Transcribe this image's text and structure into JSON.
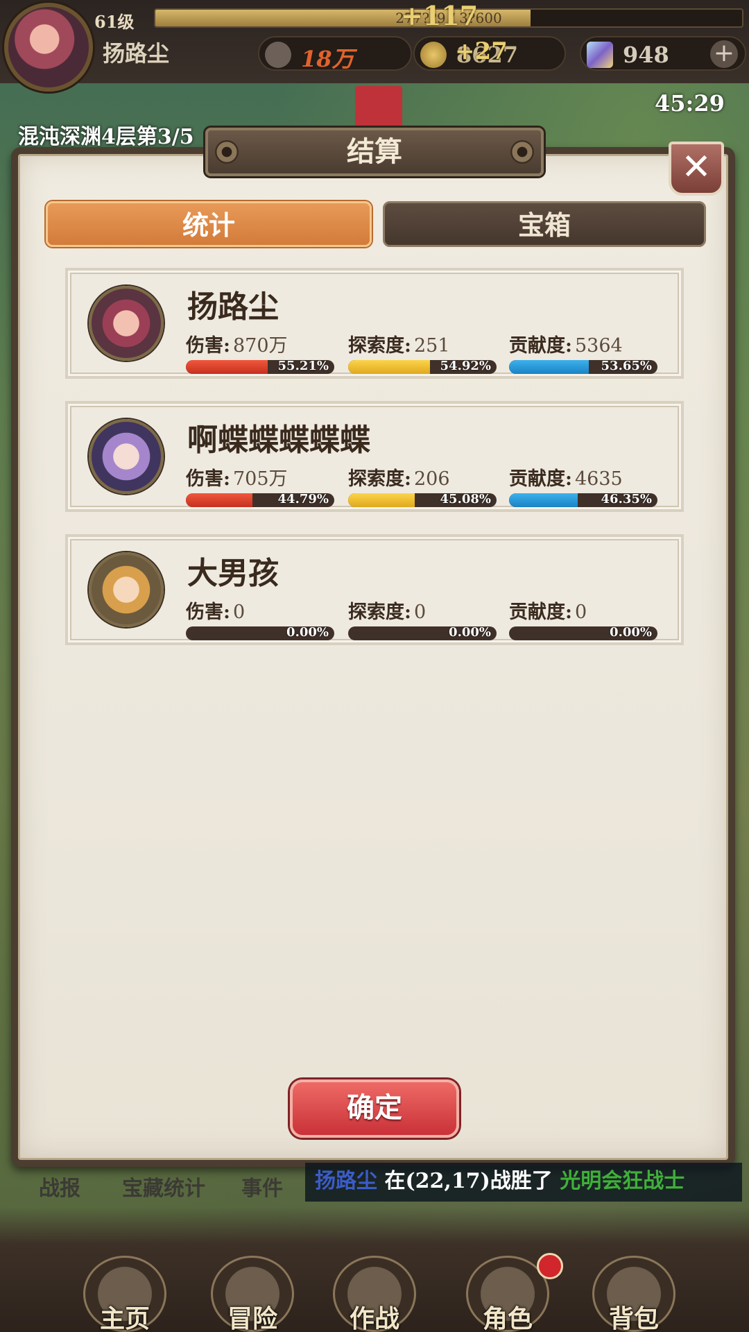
{
  "topbar": {
    "level": "61级",
    "exp_text": "277??9 / 3?600",
    "exp_percent": 64,
    "exp_gain": "+117",
    "player_name": "扬路尘",
    "power": "18万",
    "gold": "8627",
    "gold_gain": "+27",
    "gems": "948",
    "add_label": "+",
    "timer": "45:29",
    "location": "混沌深渊4层第3/5"
  },
  "dialog": {
    "title": "结算",
    "close_label": "✕",
    "tabs": [
      {
        "label": "统计",
        "active": true
      },
      {
        "label": "宝箱",
        "active": false
      }
    ],
    "stat_labels": {
      "damage": "伤害:",
      "explore": "探索度:",
      "contribution": "贡献度:"
    },
    "players": [
      {
        "name": "扬路尘",
        "damage": "870万",
        "damage_pct": "55.21%",
        "damage_fill": 55.21,
        "explore": "251",
        "explore_pct": "54.92%",
        "explore_fill": 54.92,
        "contribution": "5364",
        "contribution_pct": "53.65%",
        "contribution_fill": 53.65
      },
      {
        "name": "啊蝶蝶蝶蝶蝶",
        "damage": "705万",
        "damage_pct": "44.79%",
        "damage_fill": 44.79,
        "explore": "206",
        "explore_pct": "45.08%",
        "explore_fill": 45.08,
        "contribution": "4635",
        "contribution_pct": "46.35%",
        "contribution_fill": 46.35
      },
      {
        "name": "大男孩",
        "damage": "0",
        "damage_pct": "0.00%",
        "damage_fill": 0,
        "explore": "0",
        "explore_pct": "0.00%",
        "explore_fill": 0,
        "contribution": "0",
        "contribution_pct": "0.00%",
        "contribution_fill": 0
      }
    ],
    "confirm_label": "确定"
  },
  "bottom_tabs": [
    "战报",
    "宝藏统计",
    "事件"
  ],
  "battle_log": {
    "player": "扬路尘",
    "middle": " 在(22,17)战胜了 ",
    "enemy": "光明会狂战士"
  },
  "navbar": [
    {
      "label": "主页"
    },
    {
      "label": "冒险"
    },
    {
      "label": "作战"
    },
    {
      "label": "角色"
    },
    {
      "label": "背包"
    }
  ],
  "colors": {
    "accent_tab": "#d37b3a",
    "confirm": "#c93138",
    "damage_bar": "#e04128",
    "explore_bar": "#f0bf2a",
    "contribution_bar": "#2a98d8"
  }
}
